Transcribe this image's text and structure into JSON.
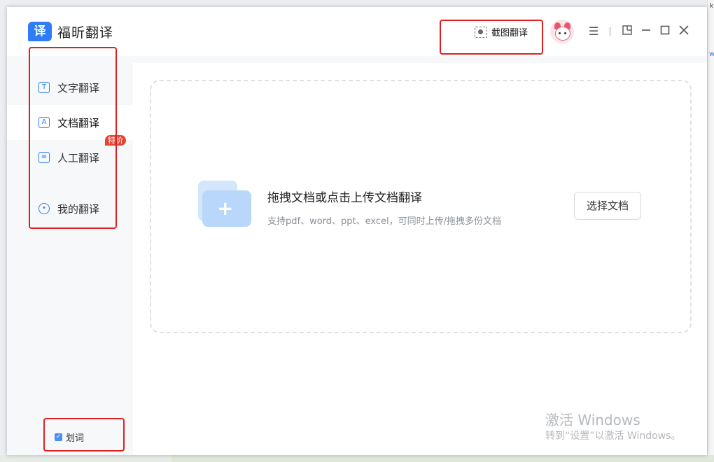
{
  "app": {
    "logo_char": "译",
    "name": "福昕翻译"
  },
  "header": {
    "screenshot_translate": "截图翻译"
  },
  "sidebar": {
    "items": [
      {
        "label": "文字翻译",
        "icon": "text-translate-icon"
      },
      {
        "label": "文档翻译",
        "icon": "document-translate-icon",
        "active": true
      },
      {
        "label": "人工翻译",
        "icon": "human-translate-icon",
        "badge": "特价"
      },
      {
        "label": "我的翻译",
        "icon": "my-translations-icon"
      }
    ],
    "word_pick": {
      "label": "划词",
      "checked": true
    }
  },
  "main": {
    "drop_title": "拖拽文档或点击上传文档翻译",
    "drop_subtitle": "支持pdf、word、ppt、excel，可同时上传/拖拽多份文档",
    "choose_button": "选择文档"
  },
  "watermark": {
    "line1": "激活 Windows",
    "line2": "转到“设置”以激活 Windows。"
  },
  "background": {
    "right_char": "k",
    "right_link": "w"
  },
  "colors": {
    "accent": "#2f7df6",
    "badge": "#e8432f",
    "highlight_box": "#e02020"
  }
}
